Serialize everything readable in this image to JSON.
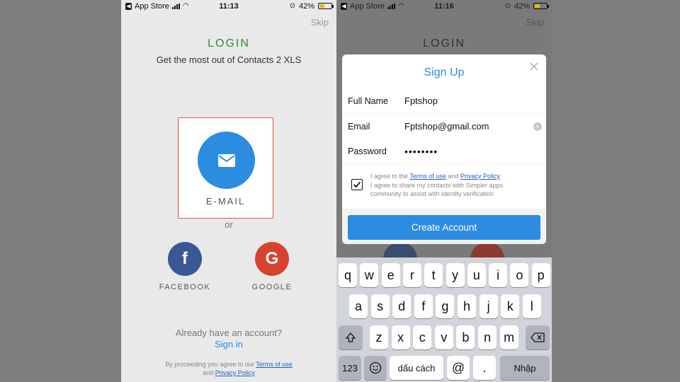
{
  "left": {
    "status": {
      "carrier": "App Store",
      "time": "11:13",
      "battery": "42%"
    },
    "skip": "Skip",
    "title": "LOGIN",
    "subtitle": "Get the most out of Contacts 2 XLS",
    "email_label": "E-MAIL",
    "or": "or",
    "facebook_label": "FACEBOOK",
    "google_label": "GOOGLE",
    "already": "Already have an account?",
    "signin": "Sign in",
    "legal_prefix": "By proceeding you agree to our",
    "terms": "Terms of use",
    "and": "and",
    "privacy": "Privacy Policy"
  },
  "right": {
    "status": {
      "carrier": "App Store",
      "time": "11:16",
      "battery": "42%"
    },
    "skip": "Skip",
    "title": "LOGIN",
    "modal": {
      "title": "Sign Up",
      "full_name_label": "Full Name",
      "full_name_value": "Fptshop",
      "email_label": "Email",
      "email_value": "Fptshop@gmail.com",
      "password_label": "Password",
      "password_value": "••••••••",
      "agree_prefix": "I agree to the",
      "terms": "Terms of use",
      "and": "and",
      "privacy": "Privacy Policy",
      "agree_line2": "I agree to share my contacts with Simpler apps",
      "agree_line3": "community to assist with identity verification",
      "create_button": "Create Account"
    },
    "keyboard": {
      "row1": [
        "q",
        "w",
        "e",
        "r",
        "t",
        "y",
        "u",
        "i",
        "o",
        "p"
      ],
      "row2": [
        "a",
        "s",
        "d",
        "f",
        "g",
        "h",
        "j",
        "k",
        "l"
      ],
      "row3": [
        "z",
        "x",
        "c",
        "v",
        "b",
        "n",
        "m"
      ],
      "numbers_key": "123",
      "space_key": "dấu cách",
      "at_key": "@",
      "dot_key": ".",
      "return_key": "Nhập"
    }
  },
  "colors": {
    "accent": "#2c8ce0",
    "login_green": "#2e8b3e",
    "facebook": "#3a5896",
    "google": "#d8432e",
    "card_border": "#e2543b"
  }
}
